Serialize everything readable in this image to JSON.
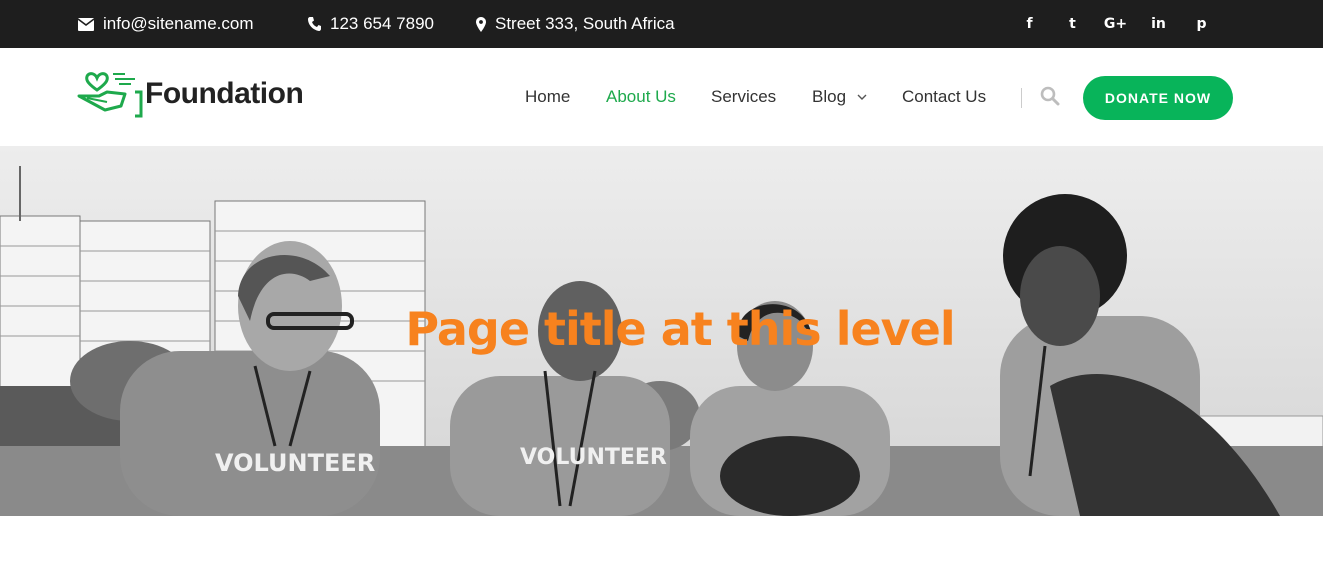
{
  "topbar": {
    "email": "info@sitename.com",
    "phone": "123 654 7890",
    "address": "Street 333, South Africa",
    "socials": [
      "f",
      "t",
      "G+",
      "in",
      "p"
    ]
  },
  "header": {
    "logo_text": "Foundation",
    "nav": {
      "home": "Home",
      "about": "About Us",
      "services": "Services",
      "blog": "Blog",
      "contact": "Contact Us"
    },
    "donate_label": "DONATE NOW"
  },
  "hero": {
    "title": "Page title at this level",
    "shirt_text": "VOLUNTEER"
  },
  "colors": {
    "accent": "#08b45a",
    "title": "#f7821e",
    "topbar": "#1e1e1e"
  }
}
